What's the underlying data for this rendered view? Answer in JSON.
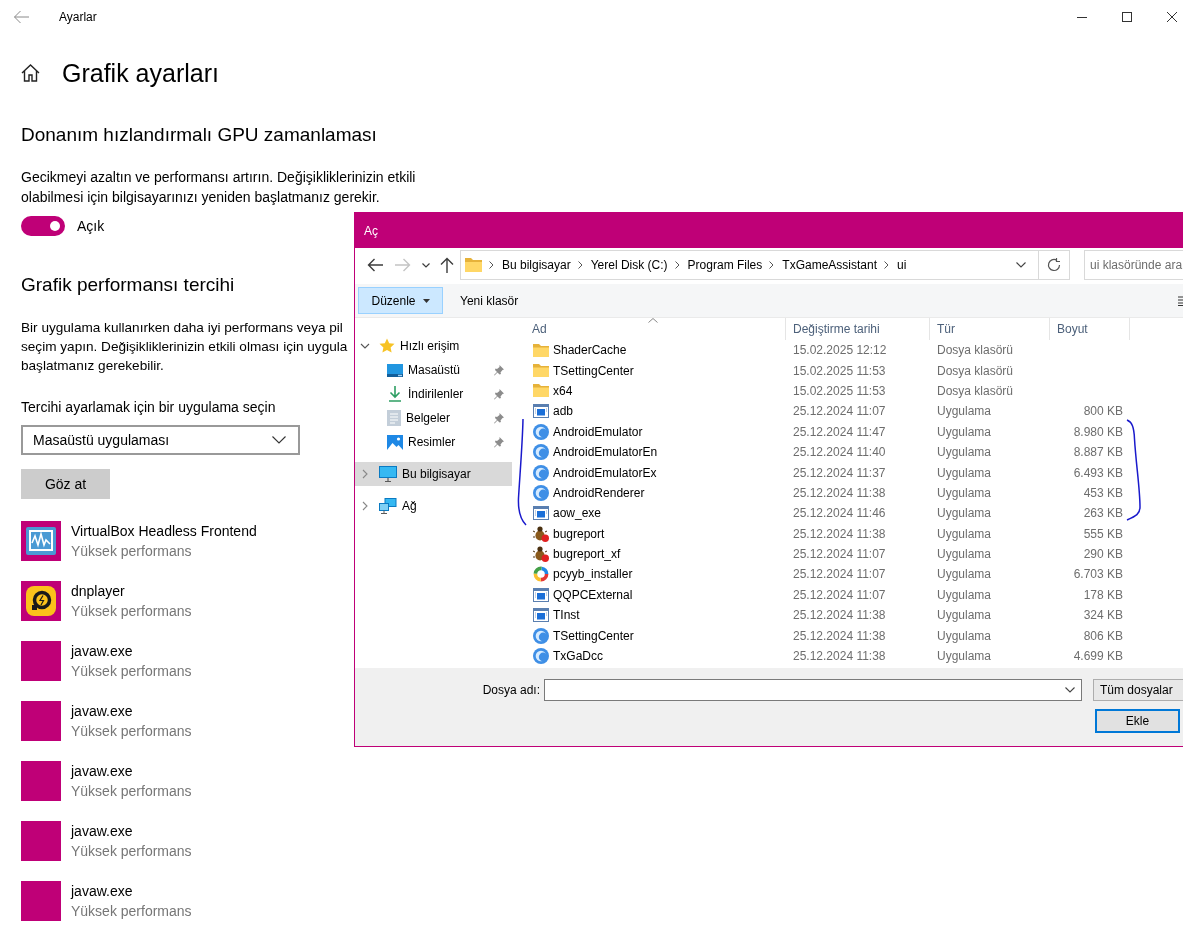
{
  "window": {
    "title": "Ayarlar"
  },
  "page": {
    "title": "Grafik ayarları"
  },
  "gpu_scheduling": {
    "heading": "Donanım hızlandırmalı GPU zamanlaması",
    "description": "Gecikmeyi azaltın ve performansı artırın. Değişikliklerinizin etkili olabilmesi için bilgisayarınızı yeniden başlatmanız gerekir.",
    "toggle": {
      "on": true,
      "label": "Açık"
    }
  },
  "performance_preference": {
    "heading": "Grafik performansı tercihi",
    "description_lines": [
      "Bir uygulama kullanırken daha iyi performans veya pil",
      "seçim yapın. Değişikliklerinizin etkili olması için uygula",
      "başlatmanız gerekebilir."
    ],
    "app_picker": {
      "label": "Tercihi ayarlamak için bir uygulama seçin",
      "value": "Masaüstü uygulaması"
    },
    "browse_button": "Göz at",
    "apps": [
      {
        "name": "VirtualBox Headless Frontend",
        "preference": "Yüksek performans",
        "kind": "monitor"
      },
      {
        "name": "dnplayer",
        "preference": "Yüksek performans",
        "kind": "player"
      },
      {
        "name": "javaw.exe",
        "preference": "Yüksek performans",
        "kind": "blank"
      },
      {
        "name": "javaw.exe",
        "preference": "Yüksek performans",
        "kind": "blank"
      },
      {
        "name": "javaw.exe",
        "preference": "Yüksek performans",
        "kind": "blank"
      },
      {
        "name": "javaw.exe",
        "preference": "Yüksek performans",
        "kind": "blank"
      },
      {
        "name": "javaw.exe",
        "preference": "Yüksek performans",
        "kind": "blank"
      }
    ]
  },
  "open_dialog": {
    "title": "Aç",
    "nav_buttons": [
      {
        "kind": "back",
        "disabled": false
      },
      {
        "kind": "forward",
        "disabled": true
      },
      {
        "kind": "recent",
        "disabled": false
      },
      {
        "kind": "up",
        "disabled": false
      }
    ],
    "breadcrumbs": [
      "Bu bilgisayar",
      "Yerel Disk (C:)",
      "Program Files",
      "TxGameAssistant",
      "ui"
    ],
    "search": {
      "placeholder": "ui klasöründe ara"
    },
    "toolbar": [
      {
        "label": "Düzenle",
        "kind": "menu",
        "active": true
      },
      {
        "label": "Yeni klasör",
        "kind": "button",
        "active": false
      }
    ],
    "nav_pane": [
      {
        "label": "Hızlı erişim",
        "kind": "star",
        "expanded": true,
        "selected": false,
        "children": [
          {
            "label": "Masaüstü",
            "kind": "desktop",
            "pinned": true,
            "selected": false
          },
          {
            "label": "İndirilenler",
            "kind": "download",
            "pinned": true,
            "selected": false
          },
          {
            "label": "Belgeler",
            "kind": "document",
            "pinned": true,
            "selected": false
          },
          {
            "label": "Resimler",
            "kind": "picture",
            "pinned": true,
            "selected": false
          }
        ]
      },
      {
        "label": "Bu bilgisayar",
        "kind": "computer",
        "expanded": false,
        "selected": true
      },
      {
        "label": "Ağ",
        "kind": "network",
        "expanded": false,
        "selected": false
      }
    ],
    "columns": [
      {
        "label": "Ad",
        "sorted": true
      },
      {
        "label": "Değiştirme tarihi",
        "sorted": false
      },
      {
        "label": "Tür",
        "sorted": false
      },
      {
        "label": "Boyut",
        "sorted": false
      }
    ],
    "files": [
      {
        "name": "ShaderCache",
        "modified": "15.02.2025 12:12",
        "type": "Dosya klasörü",
        "kind": "folder"
      },
      {
        "name": "TSettingCenter",
        "modified": "15.02.2025 11:53",
        "type": "Dosya klasörü",
        "kind": "folder"
      },
      {
        "name": "x64",
        "modified": "15.02.2025 11:53",
        "type": "Dosya klasörü",
        "kind": "folder"
      },
      {
        "name": "adb",
        "modified": "25.12.2024 11:07",
        "type": "Uygulama",
        "size": "800 KB",
        "kind": "program"
      },
      {
        "name": "AndroidEmulator",
        "modified": "25.12.2024 11:47",
        "type": "Uygulama",
        "size": "8.980 KB",
        "kind": "orb"
      },
      {
        "name": "AndroidEmulatorEn",
        "modified": "25.12.2024 11:40",
        "type": "Uygulama",
        "size": "8.887 KB",
        "kind": "orb"
      },
      {
        "name": "AndroidEmulatorEx",
        "modified": "25.12.2024 11:37",
        "type": "Uygulama",
        "size": "6.493 KB",
        "kind": "orb"
      },
      {
        "name": "AndroidRenderer",
        "modified": "25.12.2024 11:38",
        "type": "Uygulama",
        "size": "453 KB",
        "kind": "orb"
      },
      {
        "name": "aow_exe",
        "modified": "25.12.2024 11:46",
        "type": "Uygulama",
        "size": "263 KB",
        "kind": "program"
      },
      {
        "name": "bugreport",
        "modified": "25.12.2024 11:38",
        "type": "Uygulama",
        "size": "555 KB",
        "kind": "bug"
      },
      {
        "name": "bugreport_xf",
        "modified": "25.12.2024 11:07",
        "type": "Uygulama",
        "size": "290 KB",
        "kind": "bug"
      },
      {
        "name": "pcyyb_installer",
        "modified": "25.12.2024 11:07",
        "type": "Uygulama",
        "size": "6.703 KB",
        "kind": "ring"
      },
      {
        "name": "QQPCExternal",
        "modified": "25.12.2024 11:07",
        "type": "Uygulama",
        "size": "178 KB",
        "kind": "program"
      },
      {
        "name": "TInst",
        "modified": "25.12.2024 11:38",
        "type": "Uygulama",
        "size": "324 KB",
        "kind": "program"
      },
      {
        "name": "TSettingCenter",
        "modified": "25.12.2024 11:38",
        "type": "Uygulama",
        "size": "806 KB",
        "kind": "orb"
      },
      {
        "name": "TxGaDcc",
        "modified": "25.12.2024 11:38",
        "type": "Uygulama",
        "size": "4.699 KB",
        "kind": "orb"
      }
    ],
    "file_name": {
      "label": "Dosya adı:"
    },
    "file_type": "Tüm dosyalar",
    "buttons": [
      "Ekle"
    ]
  }
}
